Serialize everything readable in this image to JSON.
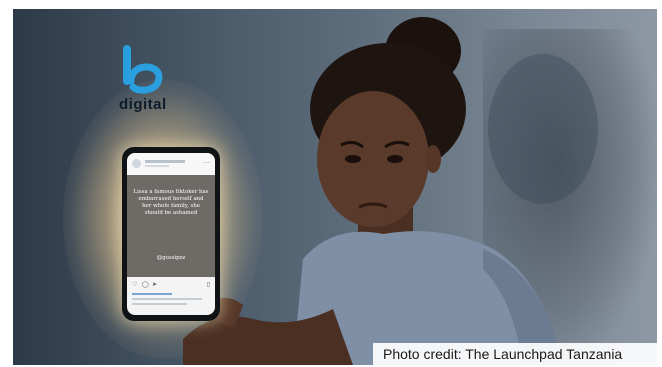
{
  "logo": {
    "mark_color": "#2a9fe0",
    "text": "digital"
  },
  "phone_post": {
    "text": "Lissa a famous tiktoker has embarrased herself and her whole family, she should be ashamed",
    "handle": "@gossipzz"
  },
  "caption": {
    "credit": "Photo credit: The Launchpad Tanzania"
  },
  "colors": {
    "background_dark": "#2d3a48",
    "glow": "#ffecbe",
    "shirt": "#7f8fa6",
    "skin": "#5a3a2a"
  }
}
